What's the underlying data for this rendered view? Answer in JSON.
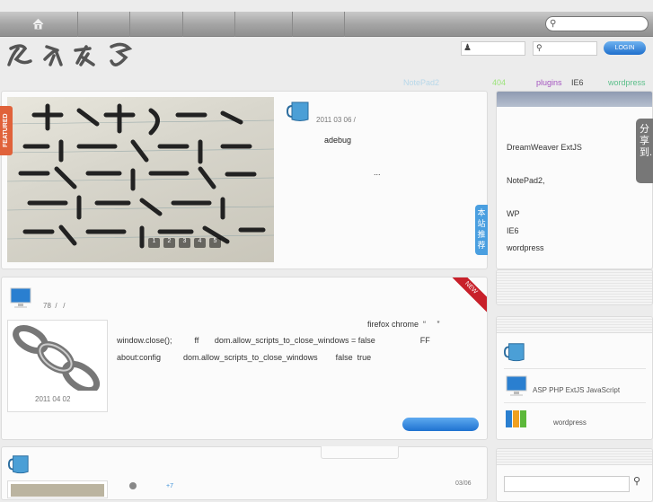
{
  "nav": {
    "search_placeholder": ""
  },
  "login": {
    "button": "LOGIN"
  },
  "tags": [
    {
      "label": "NotePad2",
      "color": "#b8d8ea"
    },
    {
      "label": "404",
      "color": "#9be37a"
    },
    {
      "label": "plugins",
      "color": "#a455c0"
    },
    {
      "label": "IE6",
      "color": "#444444"
    },
    {
      "label": "wordpress",
      "color": "#5bbf8a"
    }
  ],
  "featured": {
    "ribbon": "FEATURED",
    "slider_dots": [
      "1",
      "2",
      "3",
      "4",
      "5"
    ],
    "date": "2011 03 06 /",
    "author": "adebug",
    "excerpt": "...",
    "recommend_tab": "本站推荐"
  },
  "sidebar": {
    "lines": [
      "DreamWeaver  ExtJS",
      "NotePad2,",
      "WP",
      "IE6",
      "wordpress"
    ],
    "share_tab": "分享到...",
    "categories": [
      {
        "icon": "mug-icon",
        "label": ""
      },
      {
        "icon": "monitor-icon",
        "label": "ASP PHP ExtJS JavaScript"
      },
      {
        "icon": "folders-icon",
        "label": "wordpress"
      }
    ]
  },
  "post2": {
    "meta": "78  /   /",
    "badge": "NEW",
    "thumb_date": "2011 04 02",
    "lines": [
      "firefox chrome  “     ”",
      "window.close();          ff       dom.allow_scripts_to_close_windows = false                    FF",
      "about:config          dom.allow_scripts_to_close_windows        false  true"
    ]
  },
  "post3": {
    "count": "+7",
    "date": "03/06"
  }
}
